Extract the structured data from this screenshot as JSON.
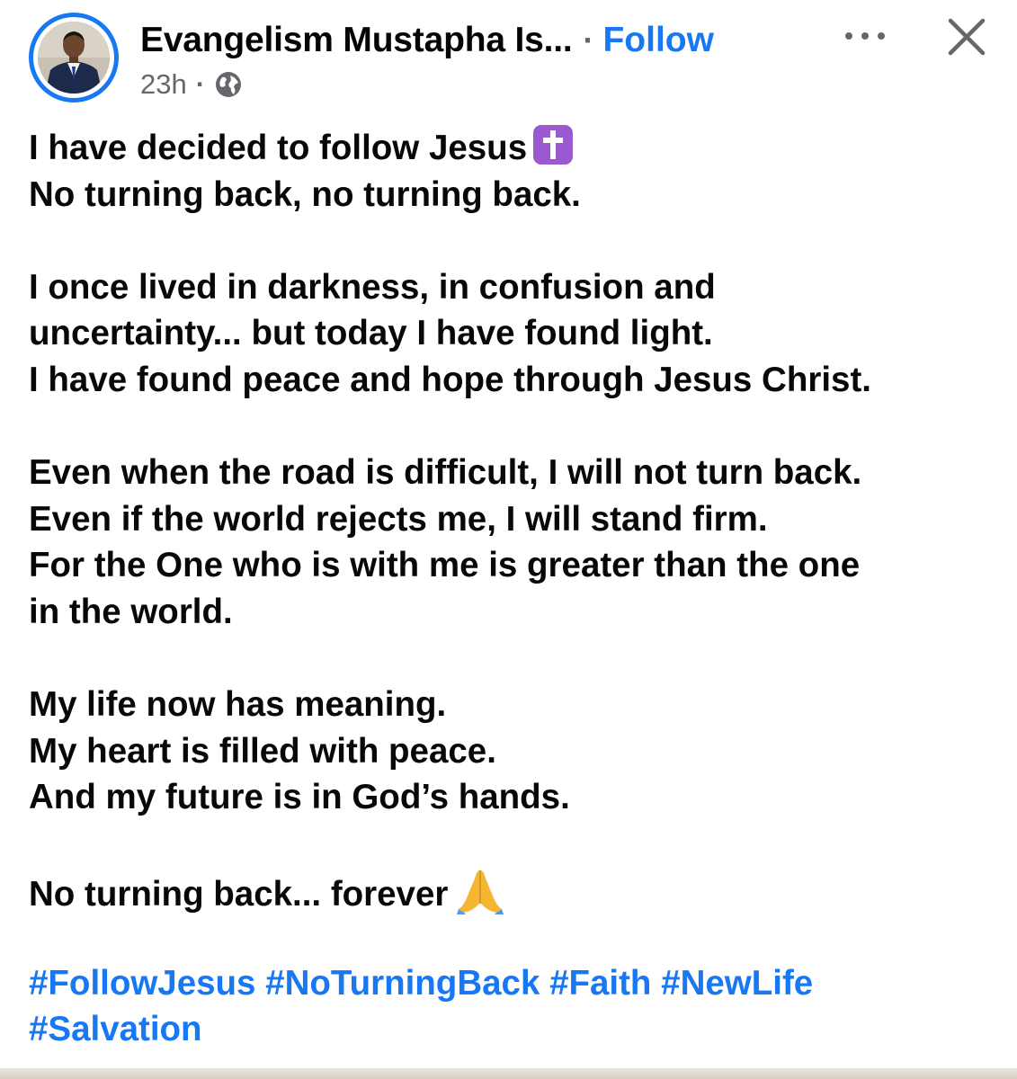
{
  "header": {
    "author_name": "Evangelism Mustapha Is...",
    "separator": "·",
    "follow_label": "Follow",
    "timestamp": "23h",
    "meta_separator": "·",
    "audience_icon": "globe-icon",
    "more_icon": "more-options-icon",
    "close_icon": "close-icon"
  },
  "post": {
    "lines": [
      "I have decided to follow Jesus",
      "No turning back, no turning back.",
      "I once lived in darkness, in confusion and",
      "uncertainty... but today I have found light.",
      "I have found peace and hope through Jesus Christ.",
      "Even when the road is difficult, I will not turn back.",
      "Even if the world rejects me, I will stand firm.",
      "For the One who is with me is greater than the one",
      "in the world.",
      "My life now has meaning.",
      "My heart is filled with peace.",
      "And my future is in God’s hands.",
      "No turning back... forever"
    ],
    "emojis": {
      "cross": "latin-cross-emoji",
      "pray": "folded-hands-emoji"
    },
    "hashtags": [
      "#FollowJesus",
      "#NoTurningBack",
      "#Faith",
      "#NewLife",
      "#Salvation"
    ]
  },
  "colors": {
    "link_blue": "#1877f2",
    "text": "#080809",
    "secondary_text": "#65676b",
    "emoji_purple": "#9b59d0"
  }
}
